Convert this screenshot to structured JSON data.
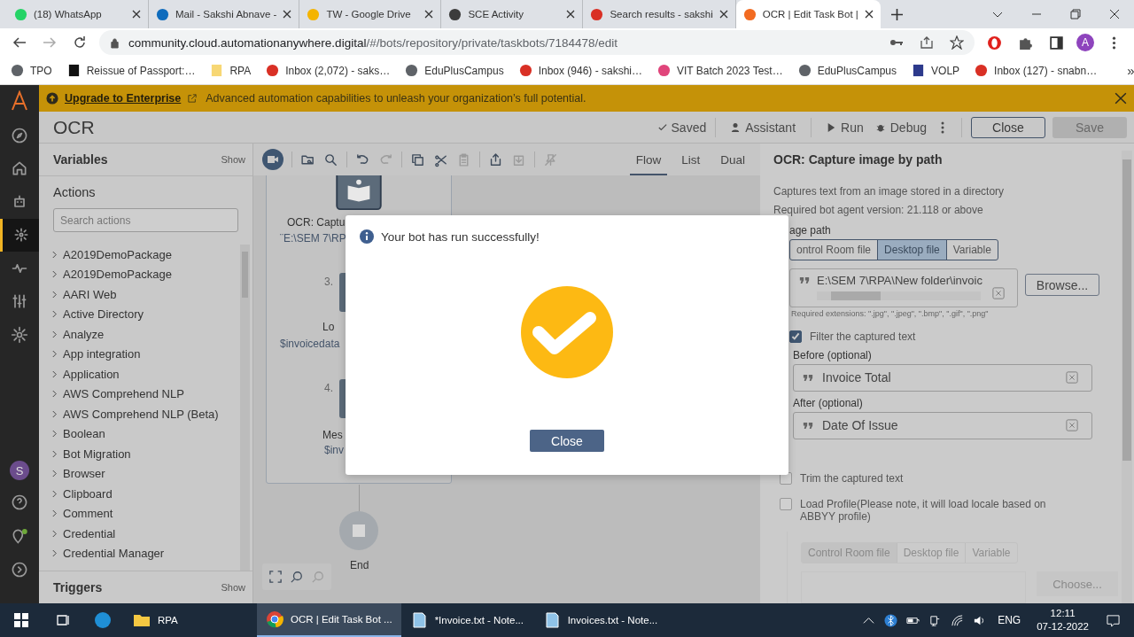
{
  "browser": {
    "tabs": [
      {
        "kind": "whatsapp",
        "title": "(18) WhatsApp",
        "selected": false
      },
      {
        "kind": "outlook",
        "title": "Mail - Sakshi Abnave -",
        "selected": false
      },
      {
        "kind": "drive",
        "title": "TW - Google Drive",
        "selected": false
      },
      {
        "kind": "sce",
        "title": "SCE Activity",
        "selected": false
      },
      {
        "kind": "gmail",
        "title": "Search results - sakshi",
        "selected": false
      },
      {
        "kind": "automation",
        "title": "OCR | Edit Task Bot |",
        "selected": true
      }
    ],
    "address": {
      "host": "community.cloud.automationanywhere.digital",
      "path": "/#/bots/repository/private/taskbots/7184478/edit"
    },
    "profile_initial": "A",
    "bookmarks": [
      {
        "kind": "globe",
        "label": "TPO"
      },
      {
        "kind": "video",
        "label": "Reissue of Passport:…"
      },
      {
        "kind": "folder",
        "label": "RPA"
      },
      {
        "kind": "gmail",
        "label": "Inbox (2,072) - saks…"
      },
      {
        "kind": "globe",
        "label": "EduPlusCampus"
      },
      {
        "kind": "gmail",
        "label": "Inbox (946) - sakshi…"
      },
      {
        "kind": "ring",
        "label": "VIT Batch 2023 Test…"
      },
      {
        "kind": "globe",
        "label": "EduPlusCampus"
      },
      {
        "kind": "square",
        "label": "VOLP"
      },
      {
        "kind": "gmail",
        "label": "Inbox (127) - snabn…"
      }
    ],
    "bookmarks_more": "»"
  },
  "nav": {
    "items": [
      {
        "kind": "compass",
        "selected": false
      },
      {
        "kind": "home",
        "selected": false
      },
      {
        "kind": "bot",
        "selected": false
      },
      {
        "kind": "hub",
        "selected": true
      },
      {
        "kind": "pulse",
        "selected": false
      },
      {
        "kind": "sliders",
        "selected": false
      },
      {
        "kind": "gear",
        "selected": false
      }
    ],
    "avatar": "S"
  },
  "banner": {
    "link": "Upgrade to Enterprise",
    "message": "Advanced automation capabilities to unleash your organization’s full potential."
  },
  "header": {
    "title": "OCR",
    "status": "Saved",
    "assistant": "Assistant",
    "run": "Run",
    "debug": "Debug",
    "close": "Close",
    "save": {
      "label": "Save",
      "disabled": true
    }
  },
  "left_panel": {
    "variables": "Variables",
    "variables_toggle": "Show",
    "actions": "Actions",
    "search": {
      "placeholder": "Search actions"
    },
    "items": [
      "A2019DemoPackage",
      "A2019DemoPackage",
      "AARI Web",
      "Active Directory",
      "Analyze",
      "App integration",
      "Application",
      "AWS Comprehend NLP",
      "AWS Comprehend NLP (Beta)",
      "Boolean",
      "Bot Migration",
      "Browser",
      "Clipboard",
      "Comment",
      "Credential",
      "Credential Manager"
    ],
    "triggers": "Triggers",
    "triggers_toggle": "Show"
  },
  "toolbar": [
    {
      "kind": "record",
      "disabled": false
    },
    {
      "kind": "folder-search",
      "disabled": false
    },
    {
      "kind": "search",
      "disabled": false
    },
    {
      "kind": "undo",
      "disabled": false
    },
    {
      "kind": "redo",
      "disabled": true
    },
    {
      "kind": "copy",
      "disabled": false
    },
    {
      "kind": "cut",
      "disabled": false
    },
    {
      "kind": "paste",
      "disabled": true
    },
    {
      "kind": "export",
      "disabled": false
    },
    {
      "kind": "import",
      "disabled": true
    },
    {
      "kind": "disable",
      "disabled": true
    }
  ],
  "views": [
    {
      "label": "Flow",
      "selected": true
    },
    {
      "label": "List",
      "selected": false
    },
    {
      "label": "Dual",
      "selected": false
    }
  ],
  "flow": {
    "first": {
      "label": "OCR: Captu",
      "detail": "¨E:\\SEM 7\\RP"
    },
    "steps": [
      {
        "number": "3.",
        "label": "Lo",
        "detail": "$invoicedata"
      },
      {
        "number": "4.",
        "label": "Mes",
        "detail": "$inv"
      }
    ],
    "end": "End"
  },
  "dialog": {
    "message": "Your bot has run successfully!",
    "button": "Close"
  },
  "properties": {
    "title": "OCR: Capture image by path",
    "description": "Captures text from an image stored in a directory",
    "version": "Required bot agent version: 21.118 or above",
    "path_label": "age path",
    "sources": [
      {
        "label": "ontrol Room file",
        "selected": false
      },
      {
        "label": "Desktop file",
        "selected": true
      },
      {
        "label": "Variable",
        "selected": false
      }
    ],
    "path_value": "E:\\SEM 7\\RPA\\New folder\\invoic",
    "browse": "Browse...",
    "hint": "Required extensions: \".jpg\", \".jpeg\", \".bmp\", \".gif\", \".png\"",
    "filter": {
      "label": "Filter the captured text",
      "checked": true
    },
    "before": {
      "label": "Before (optional)",
      "value": "Invoice Total"
    },
    "after": {
      "label": "After (optional)",
      "value": "Date Of Issue"
    },
    "trim": {
      "label": "Trim the captured text",
      "checked": false
    },
    "profile": {
      "label": "Load Profile(Please note, it will load locale based on ABBYY profile)",
      "checked": false
    },
    "profile_sources": [
      "Control Room file",
      "Desktop file",
      "Variable"
    ],
    "choose": "Choose..."
  },
  "taskbar": {
    "apps": [
      {
        "kind": "edge",
        "selected": false
      },
      {
        "kind": "folder",
        "label": "RPA",
        "selected": false
      },
      {
        "kind": "chrome",
        "label": "OCR | Edit Task Bot ...",
        "selected": true
      },
      {
        "kind": "notepad",
        "label": "*Invoice.txt - Note...",
        "selected": false
      },
      {
        "kind": "notepad",
        "label": "Invoices.txt - Note...",
        "selected": false
      }
    ],
    "language": "ENG",
    "time": "12:11",
    "date": "07-12-2022"
  }
}
